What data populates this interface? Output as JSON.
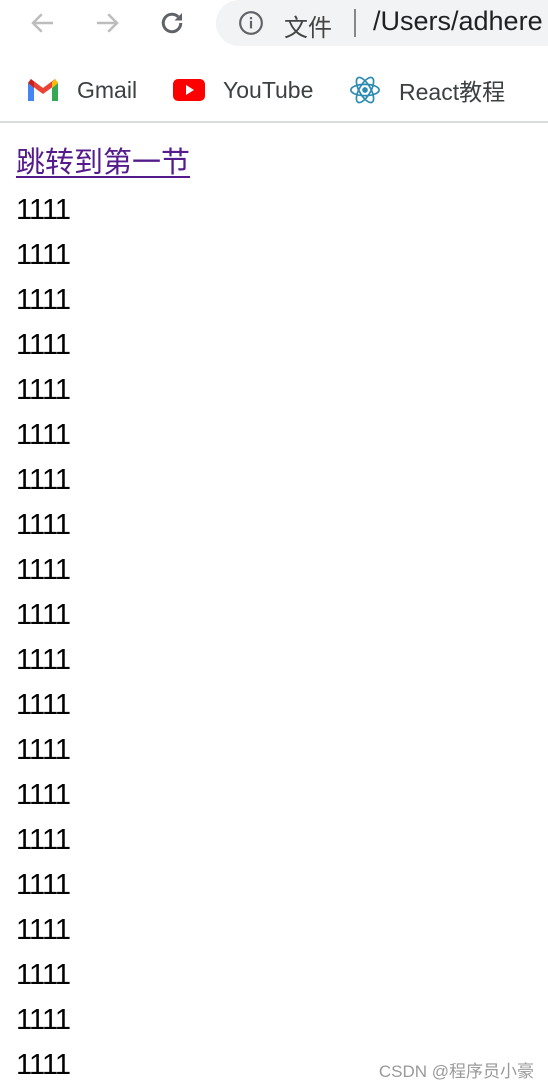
{
  "browser": {
    "scheme_label": "文件",
    "url": "/Users/adhere",
    "nav": {
      "back_icon": "arrow-left-icon",
      "forward_icon": "arrow-right-icon",
      "reload_icon": "reload-icon"
    }
  },
  "bookmarks": [
    {
      "label": "Gmail",
      "icon": "gmail-icon"
    },
    {
      "label": "YouTube",
      "icon": "youtube-icon"
    },
    {
      "label": "React教程",
      "icon": "react-icon"
    }
  ],
  "page": {
    "anchor_link": "跳转到第一节",
    "lines": [
      "1111",
      "1111",
      "1111",
      "1111",
      "1111",
      "1111",
      "1111",
      "1111",
      "1111",
      "1111",
      "1111",
      "1111",
      "1111",
      "1111",
      "1111",
      "1111",
      "1111",
      "1111",
      "1111",
      "1111"
    ]
  },
  "watermark": "CSDN @程序员小豪"
}
